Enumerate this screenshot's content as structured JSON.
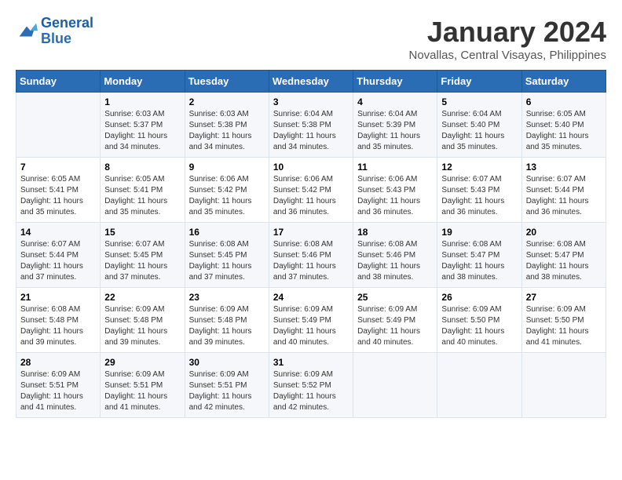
{
  "logo": {
    "line1": "General",
    "line2": "Blue"
  },
  "title": "January 2024",
  "subtitle": "Novallas, Central Visayas, Philippines",
  "days_of_week": [
    "Sunday",
    "Monday",
    "Tuesday",
    "Wednesday",
    "Thursday",
    "Friday",
    "Saturday"
  ],
  "weeks": [
    [
      {
        "day": "",
        "info": ""
      },
      {
        "day": "1",
        "info": "Sunrise: 6:03 AM\nSunset: 5:37 PM\nDaylight: 11 hours\nand 34 minutes."
      },
      {
        "day": "2",
        "info": "Sunrise: 6:03 AM\nSunset: 5:38 PM\nDaylight: 11 hours\nand 34 minutes."
      },
      {
        "day": "3",
        "info": "Sunrise: 6:04 AM\nSunset: 5:38 PM\nDaylight: 11 hours\nand 34 minutes."
      },
      {
        "day": "4",
        "info": "Sunrise: 6:04 AM\nSunset: 5:39 PM\nDaylight: 11 hours\nand 35 minutes."
      },
      {
        "day": "5",
        "info": "Sunrise: 6:04 AM\nSunset: 5:40 PM\nDaylight: 11 hours\nand 35 minutes."
      },
      {
        "day": "6",
        "info": "Sunrise: 6:05 AM\nSunset: 5:40 PM\nDaylight: 11 hours\nand 35 minutes."
      }
    ],
    [
      {
        "day": "7",
        "info": "Sunrise: 6:05 AM\nSunset: 5:41 PM\nDaylight: 11 hours\nand 35 minutes."
      },
      {
        "day": "8",
        "info": "Sunrise: 6:05 AM\nSunset: 5:41 PM\nDaylight: 11 hours\nand 35 minutes."
      },
      {
        "day": "9",
        "info": "Sunrise: 6:06 AM\nSunset: 5:42 PM\nDaylight: 11 hours\nand 35 minutes."
      },
      {
        "day": "10",
        "info": "Sunrise: 6:06 AM\nSunset: 5:42 PM\nDaylight: 11 hours\nand 36 minutes."
      },
      {
        "day": "11",
        "info": "Sunrise: 6:06 AM\nSunset: 5:43 PM\nDaylight: 11 hours\nand 36 minutes."
      },
      {
        "day": "12",
        "info": "Sunrise: 6:07 AM\nSunset: 5:43 PM\nDaylight: 11 hours\nand 36 minutes."
      },
      {
        "day": "13",
        "info": "Sunrise: 6:07 AM\nSunset: 5:44 PM\nDaylight: 11 hours\nand 36 minutes."
      }
    ],
    [
      {
        "day": "14",
        "info": "Sunrise: 6:07 AM\nSunset: 5:44 PM\nDaylight: 11 hours\nand 37 minutes."
      },
      {
        "day": "15",
        "info": "Sunrise: 6:07 AM\nSunset: 5:45 PM\nDaylight: 11 hours\nand 37 minutes."
      },
      {
        "day": "16",
        "info": "Sunrise: 6:08 AM\nSunset: 5:45 PM\nDaylight: 11 hours\nand 37 minutes."
      },
      {
        "day": "17",
        "info": "Sunrise: 6:08 AM\nSunset: 5:46 PM\nDaylight: 11 hours\nand 37 minutes."
      },
      {
        "day": "18",
        "info": "Sunrise: 6:08 AM\nSunset: 5:46 PM\nDaylight: 11 hours\nand 38 minutes."
      },
      {
        "day": "19",
        "info": "Sunrise: 6:08 AM\nSunset: 5:47 PM\nDaylight: 11 hours\nand 38 minutes."
      },
      {
        "day": "20",
        "info": "Sunrise: 6:08 AM\nSunset: 5:47 PM\nDaylight: 11 hours\nand 38 minutes."
      }
    ],
    [
      {
        "day": "21",
        "info": "Sunrise: 6:08 AM\nSunset: 5:48 PM\nDaylight: 11 hours\nand 39 minutes."
      },
      {
        "day": "22",
        "info": "Sunrise: 6:09 AM\nSunset: 5:48 PM\nDaylight: 11 hours\nand 39 minutes."
      },
      {
        "day": "23",
        "info": "Sunrise: 6:09 AM\nSunset: 5:48 PM\nDaylight: 11 hours\nand 39 minutes."
      },
      {
        "day": "24",
        "info": "Sunrise: 6:09 AM\nSunset: 5:49 PM\nDaylight: 11 hours\nand 40 minutes."
      },
      {
        "day": "25",
        "info": "Sunrise: 6:09 AM\nSunset: 5:49 PM\nDaylight: 11 hours\nand 40 minutes."
      },
      {
        "day": "26",
        "info": "Sunrise: 6:09 AM\nSunset: 5:50 PM\nDaylight: 11 hours\nand 40 minutes."
      },
      {
        "day": "27",
        "info": "Sunrise: 6:09 AM\nSunset: 5:50 PM\nDaylight: 11 hours\nand 41 minutes."
      }
    ],
    [
      {
        "day": "28",
        "info": "Sunrise: 6:09 AM\nSunset: 5:51 PM\nDaylight: 11 hours\nand 41 minutes."
      },
      {
        "day": "29",
        "info": "Sunrise: 6:09 AM\nSunset: 5:51 PM\nDaylight: 11 hours\nand 41 minutes."
      },
      {
        "day": "30",
        "info": "Sunrise: 6:09 AM\nSunset: 5:51 PM\nDaylight: 11 hours\nand 42 minutes."
      },
      {
        "day": "31",
        "info": "Sunrise: 6:09 AM\nSunset: 5:52 PM\nDaylight: 11 hours\nand 42 minutes."
      },
      {
        "day": "",
        "info": ""
      },
      {
        "day": "",
        "info": ""
      },
      {
        "day": "",
        "info": ""
      }
    ]
  ]
}
